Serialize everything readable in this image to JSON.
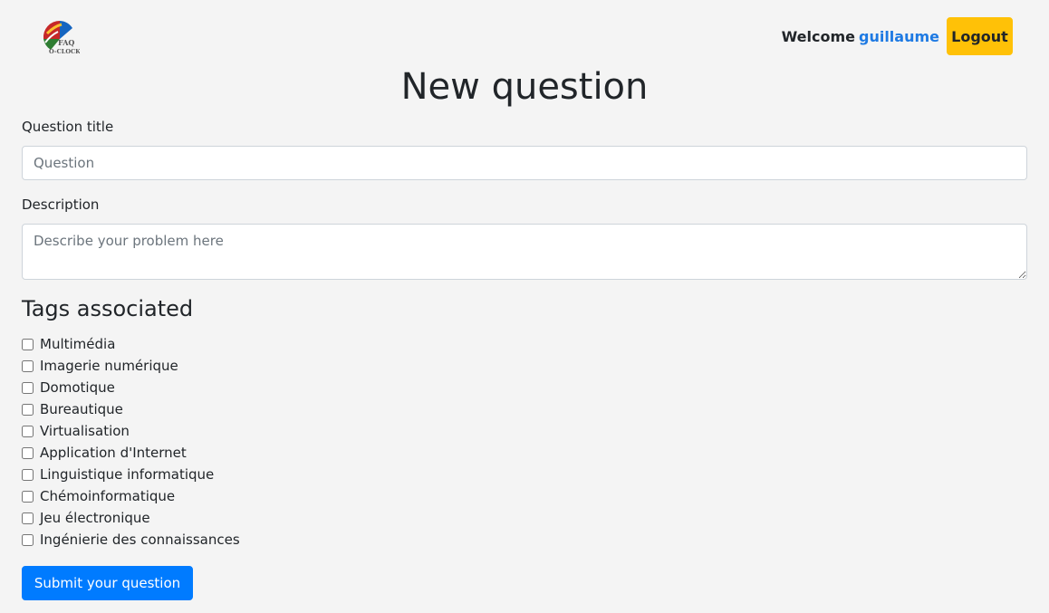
{
  "header": {
    "logo_text_top": "FAQ",
    "logo_text_bottom": "O-CLOCK",
    "welcome_label": "Welcome",
    "username": "guillaume",
    "logout_label": "Logout"
  },
  "page_title": "New question",
  "form": {
    "title_label": "Question title",
    "title_placeholder": "Question",
    "description_label": "Description",
    "description_placeholder": "Describe your problem here",
    "tags_heading": "Tags associated",
    "tags": [
      {
        "label": "Multimédia",
        "checked": false
      },
      {
        "label": "Imagerie numérique",
        "checked": false
      },
      {
        "label": "Domotique",
        "checked": false
      },
      {
        "label": "Bureautique",
        "checked": false
      },
      {
        "label": "Virtualisation",
        "checked": false
      },
      {
        "label": "Application d'Internet",
        "checked": false
      },
      {
        "label": "Linguistique informatique",
        "checked": false
      },
      {
        "label": "Chémoinformatique",
        "checked": false
      },
      {
        "label": "Jeu électronique",
        "checked": false
      },
      {
        "label": "Ingénierie des connaissances",
        "checked": false
      }
    ],
    "submit_label": "Submit your question"
  },
  "colors": {
    "background": "#f4f4f4",
    "primary": "#007bff",
    "warning": "#ffc107",
    "username": "#1e7ae3"
  }
}
